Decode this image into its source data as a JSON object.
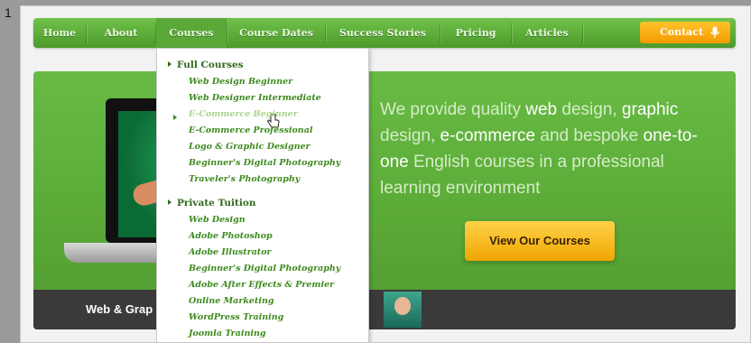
{
  "step_number": "1",
  "nav": {
    "items": [
      "Home",
      "About",
      "Courses",
      "Course Dates",
      "Success Stories",
      "Pricing",
      "Articles"
    ],
    "contact_label": "Contact"
  },
  "hero": {
    "tagline_parts": [
      {
        "text": "We provide quality ",
        "strong": false
      },
      {
        "text": "web",
        "strong": true
      },
      {
        "text": " design, ",
        "strong": false
      },
      {
        "text": "graphic",
        "strong": true
      },
      {
        "text": " design, ",
        "strong": false
      },
      {
        "text": "e-commerce",
        "strong": true
      },
      {
        "text": " and bespoke ",
        "strong": false
      },
      {
        "text": "one-to-one",
        "strong": true
      },
      {
        "text": " English courses in a professional learning environment",
        "strong": false
      }
    ],
    "cta_label": "View Our Courses",
    "caption": "Web & Grap"
  },
  "dropdown": {
    "full_courses_heading": "Full Courses",
    "full_courses": [
      "Web Design Beginner",
      "Web Designer Intermediate",
      "E-Commerce Beginner",
      "E-Commerce Professional",
      "Logo & Graphic Designer",
      "Beginner's Digital Photography",
      "Traveler's Photography"
    ],
    "private_heading": "Private Tuition",
    "private_items": [
      "Web Design",
      "Adobe Photoshop",
      "Adobe Illustrator",
      "Beginner's Digital Photography",
      "Adobe After Effects & Premier",
      "Online Marketing",
      "WordPress Training",
      "Joomla Training"
    ]
  },
  "colors": {
    "nav_green": "#5aa837",
    "hero_green": "#5aa937",
    "cta_yellow": "#f0a500",
    "link_green": "#3d8a1d"
  }
}
